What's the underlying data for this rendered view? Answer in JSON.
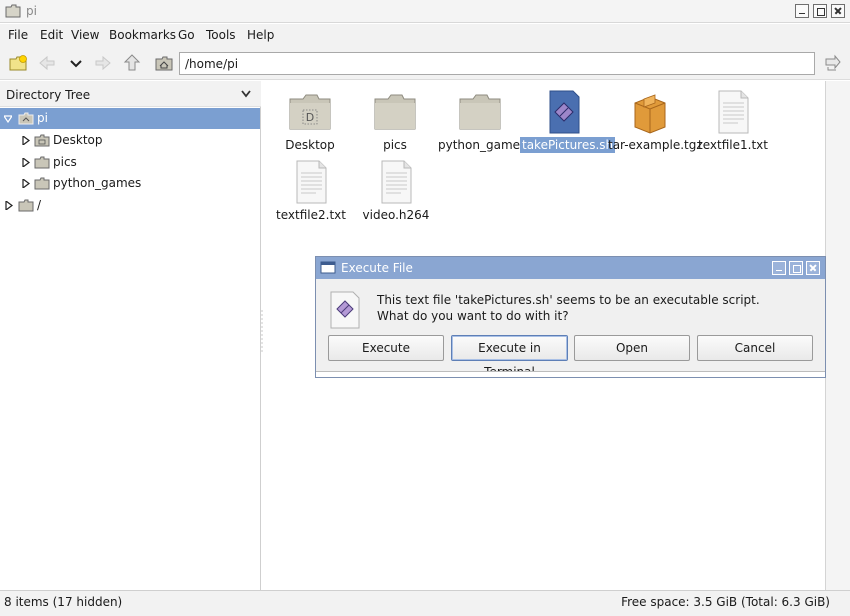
{
  "window": {
    "title": "pi",
    "icon": "folder-icon"
  },
  "menu": {
    "items": [
      "File",
      "Edit",
      "View",
      "Bookmarks",
      "Go",
      "Tools",
      "Help"
    ]
  },
  "toolbar": {
    "path": "/home/pi",
    "icons": [
      "new-tab-icon",
      "back-icon",
      "history-dropdown-icon",
      "forward-icon",
      "up-icon",
      "home-icon",
      "go-icon"
    ]
  },
  "sidepane": {
    "header": "Directory Tree",
    "tree": [
      {
        "label": "pi",
        "expanded": true,
        "selected": true,
        "icon": "home-folder-icon"
      },
      {
        "label": "Desktop",
        "expanded": false,
        "icon": "desktop-folder-icon"
      },
      {
        "label": "pics",
        "expanded": false,
        "icon": "folder-icon"
      },
      {
        "label": "python_games",
        "expanded": false,
        "icon": "folder-icon"
      },
      {
        "label": "/",
        "expanded": false,
        "icon": "folder-icon"
      }
    ]
  },
  "files": [
    {
      "name": "Desktop",
      "type": "desktop-folder"
    },
    {
      "name": "pics",
      "type": "folder"
    },
    {
      "name": "python_games",
      "type": "folder"
    },
    {
      "name": "takePictures.sh",
      "type": "script",
      "selected": true
    },
    {
      "name": "tar-example.tgz",
      "type": "archive"
    },
    {
      "name": "textfile1.txt",
      "type": "text"
    },
    {
      "name": "textfile2.txt",
      "type": "text"
    },
    {
      "name": "video.h264",
      "type": "text"
    }
  ],
  "status": {
    "left": "8 items (17 hidden)",
    "right": "Free space: 3.5 GiB (Total: 6.3 GiB)"
  },
  "dialog": {
    "title": "Execute File",
    "message_line1": "This text file 'takePictures.sh' seems to be an executable script.",
    "message_line2": "What do you want to do with it?",
    "buttons": {
      "execute": "Execute",
      "execute_terminal": "Execute in Terminal",
      "open": "Open",
      "cancel": "Cancel"
    }
  },
  "colors": {
    "selection": "#7b9fd1",
    "dialog_title": "#8aa6d2",
    "folder": "#c9c6b8",
    "script": "#4a6fb0",
    "archive": "#e09a3a"
  }
}
